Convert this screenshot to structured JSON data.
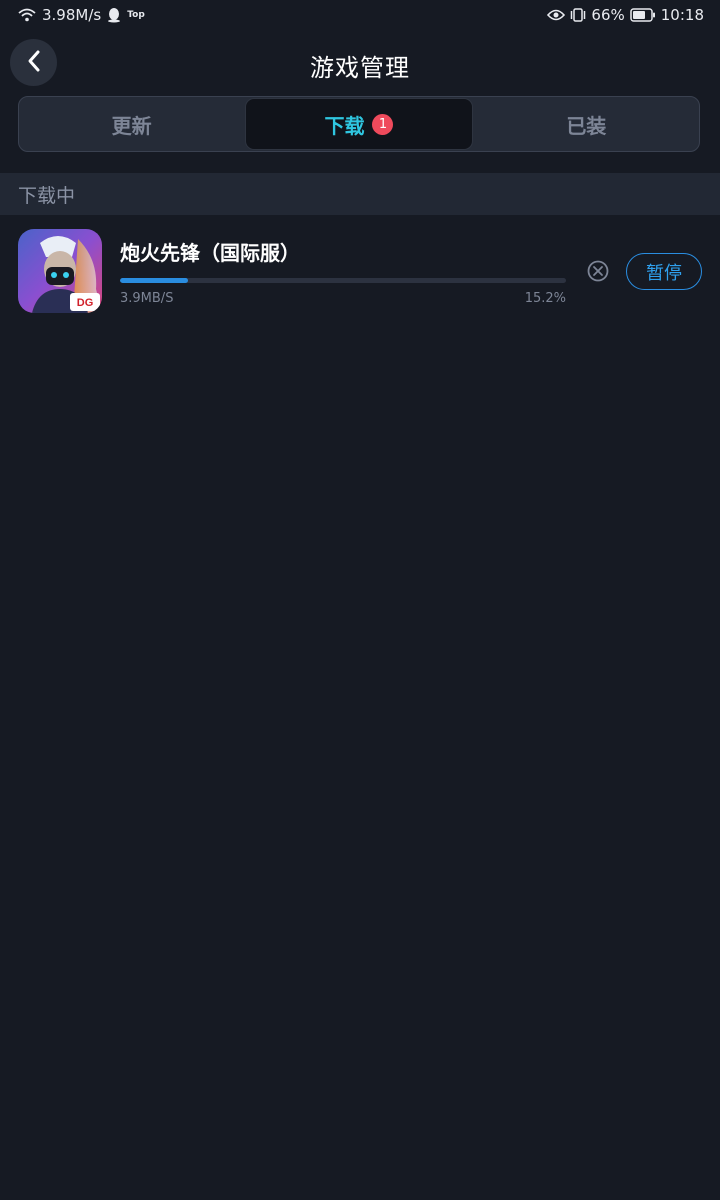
{
  "status_bar": {
    "net_speed": "3.98M/s",
    "top_label": "Top",
    "battery": "66%",
    "time": "10:18",
    "icons": [
      "wifi-icon",
      "qq-icon",
      "eye-icon",
      "vibrate-icon",
      "battery-icon"
    ]
  },
  "header": {
    "title": "游戏管理",
    "back_icon": "chevron-left-icon"
  },
  "tabs": [
    {
      "label": "更新",
      "active": false
    },
    {
      "label": "下载",
      "active": true,
      "badge": "1"
    },
    {
      "label": "已装",
      "active": false
    }
  ],
  "section": {
    "title": "下载中"
  },
  "downloads": [
    {
      "name": "炮火先锋（国际服）",
      "speed": "3.9MB/S",
      "percent_text": "15.2%",
      "progress": 0.152,
      "pause_label": "暂停",
      "cancel_icon": "close-circle-icon"
    }
  ],
  "colors": {
    "background": "#161a23",
    "accent_cyan": "#2fc6e0",
    "accent_blue": "#2a8de0",
    "badge_red": "#ef4a5c"
  }
}
